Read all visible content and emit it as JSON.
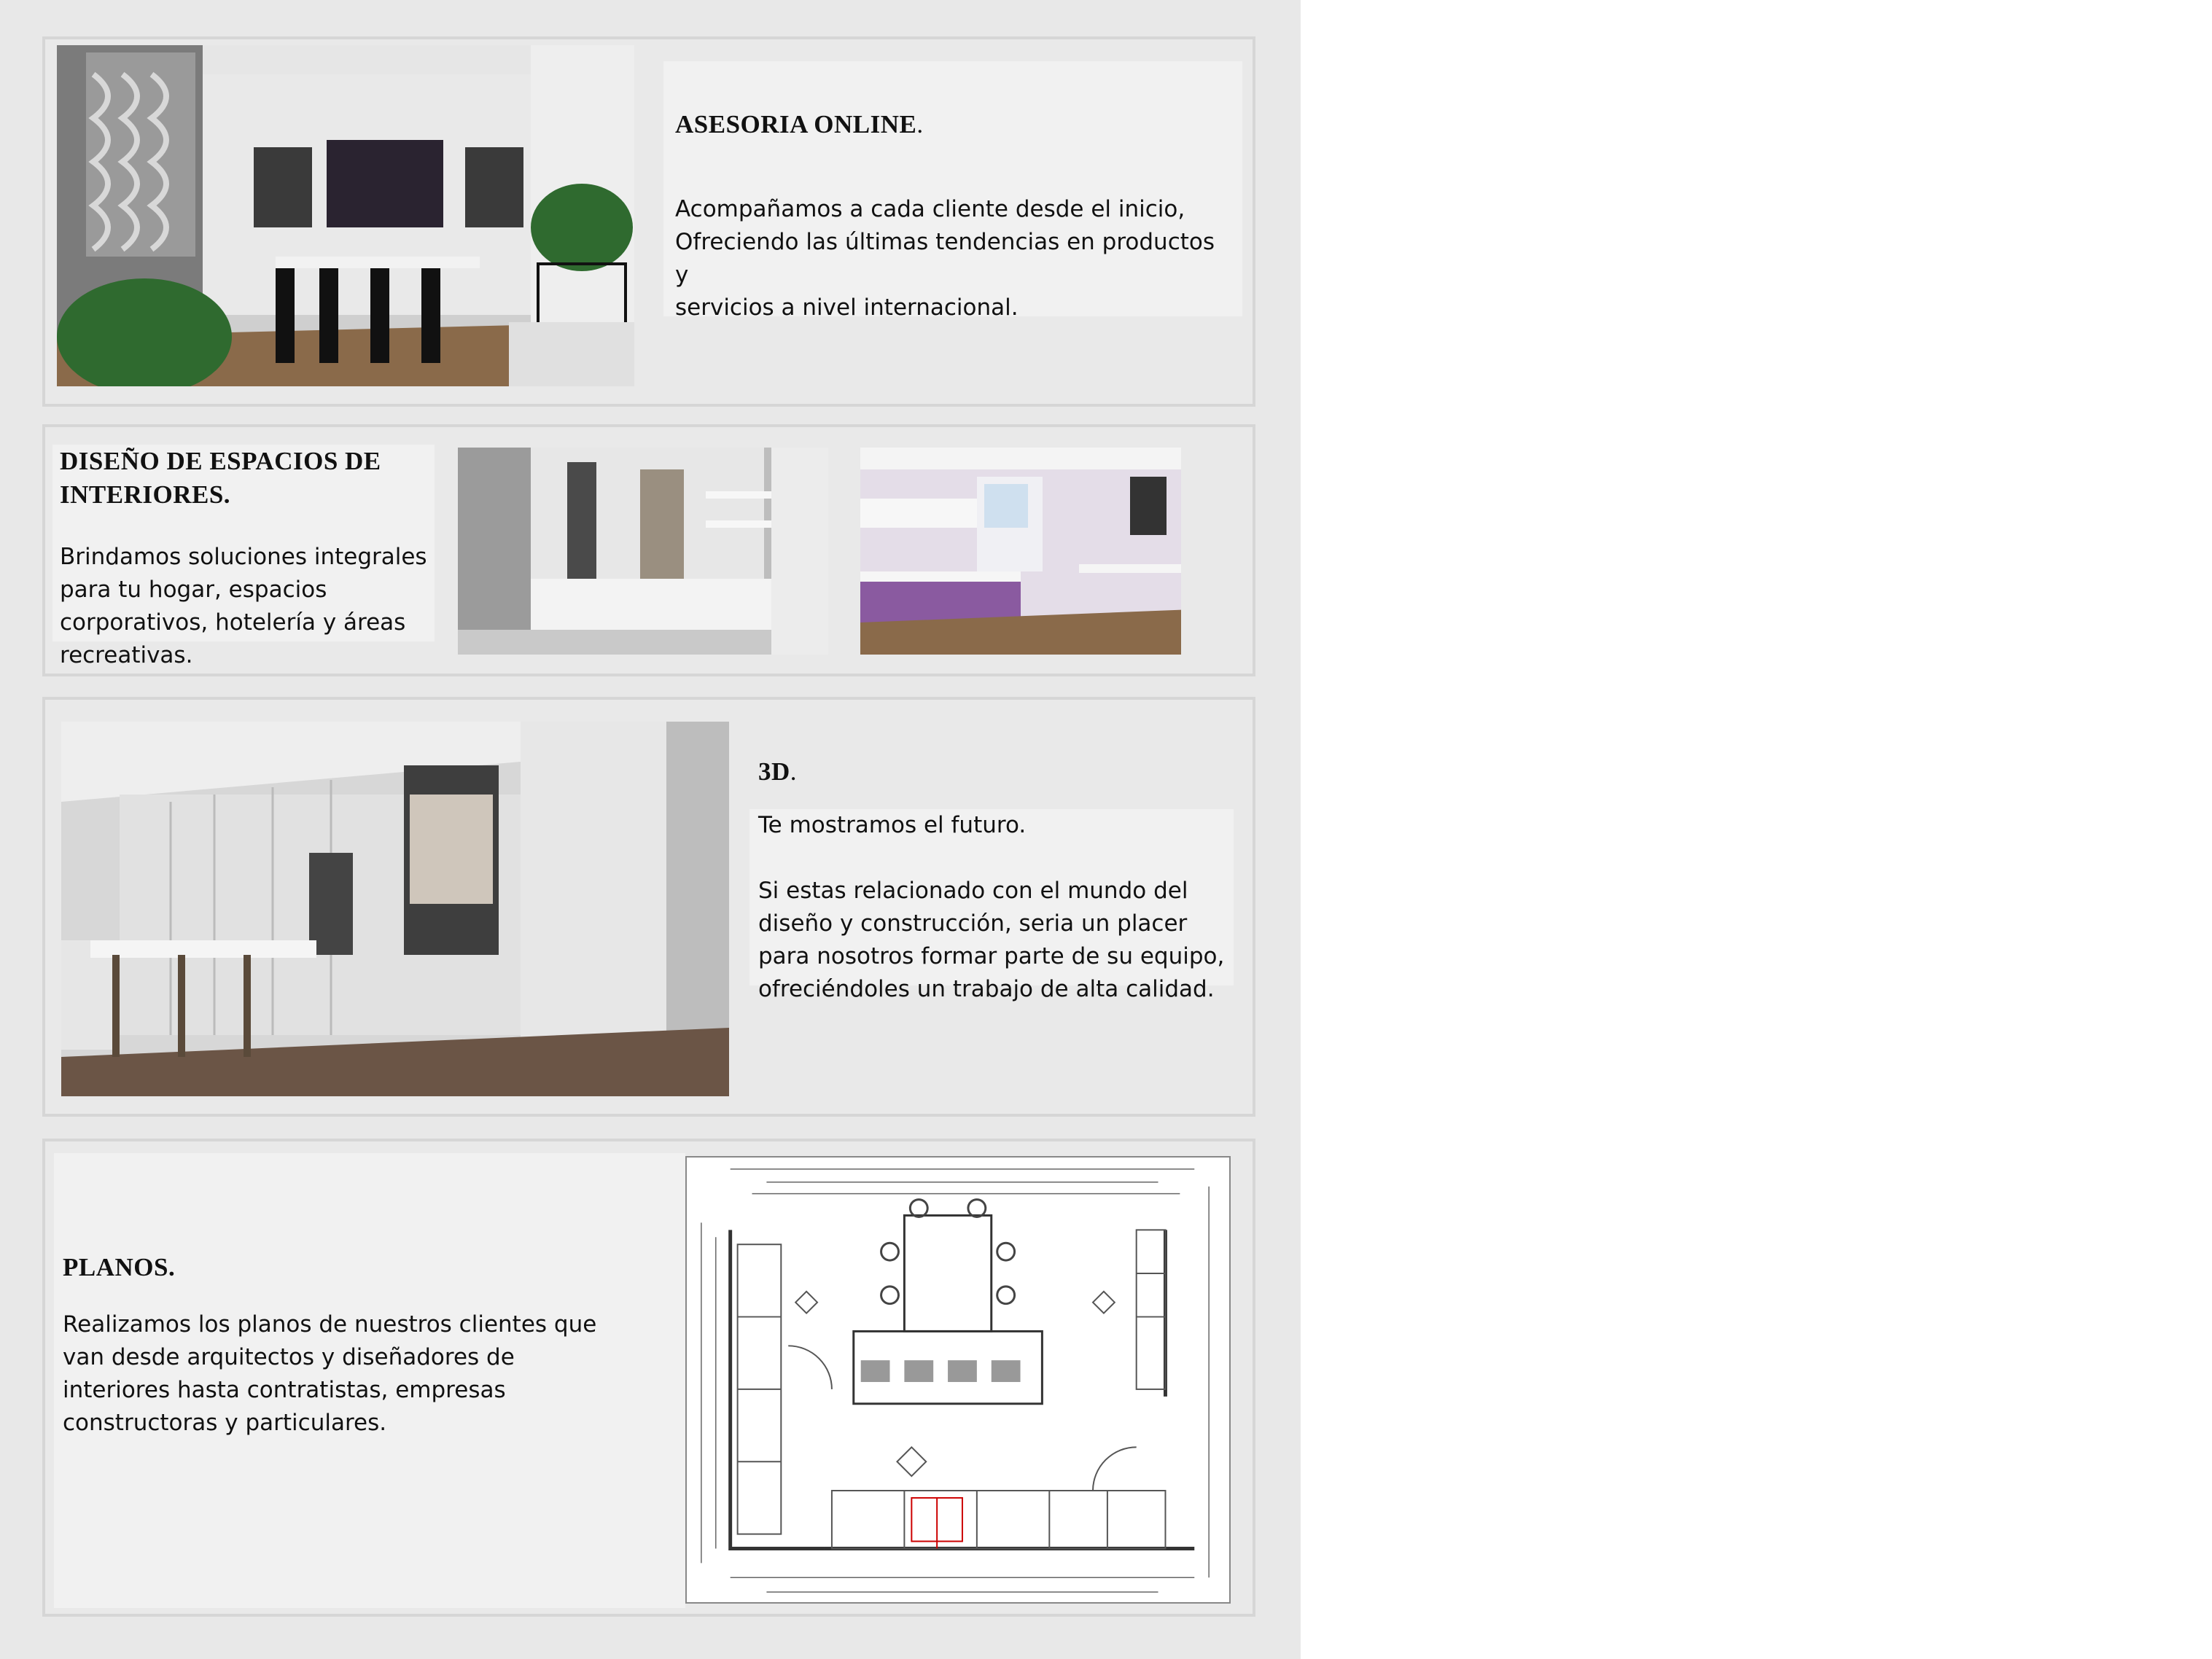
{
  "sections": {
    "asesoria": {
      "title": "ASESORIA ONLINE",
      "title_suffix": ".",
      "body": "Acompañamos a cada cliente desde el inicio,\nOfreciendo las últimas tendencias en productos y\nservicios a nivel internacional."
    },
    "diseno": {
      "title": "DISEÑO DE ESPACIOS DE\nINTERIORES.",
      "body": "Brindamos soluciones integrales\npara tu hogar, espacios\ncorporativos, hotelería y áreas\nrecreativas."
    },
    "tres_d": {
      "title": "3D",
      "title_suffix": ".",
      "tagline": "Te mostramos el futuro.",
      "body": "Si estas relacionado con el mundo del\ndiseño y construcción, seria un placer\npara nosotros formar parte de su equipo,\nofreciéndoles un trabajo de alta calidad."
    },
    "planos": {
      "title": "PLANOS.",
      "body": "Realizamos los planos de nuestros clientes que\nvan desde arquitectos y diseñadores de\ninteriores hasta contratistas, empresas\nconstructoras y particulares."
    }
  }
}
